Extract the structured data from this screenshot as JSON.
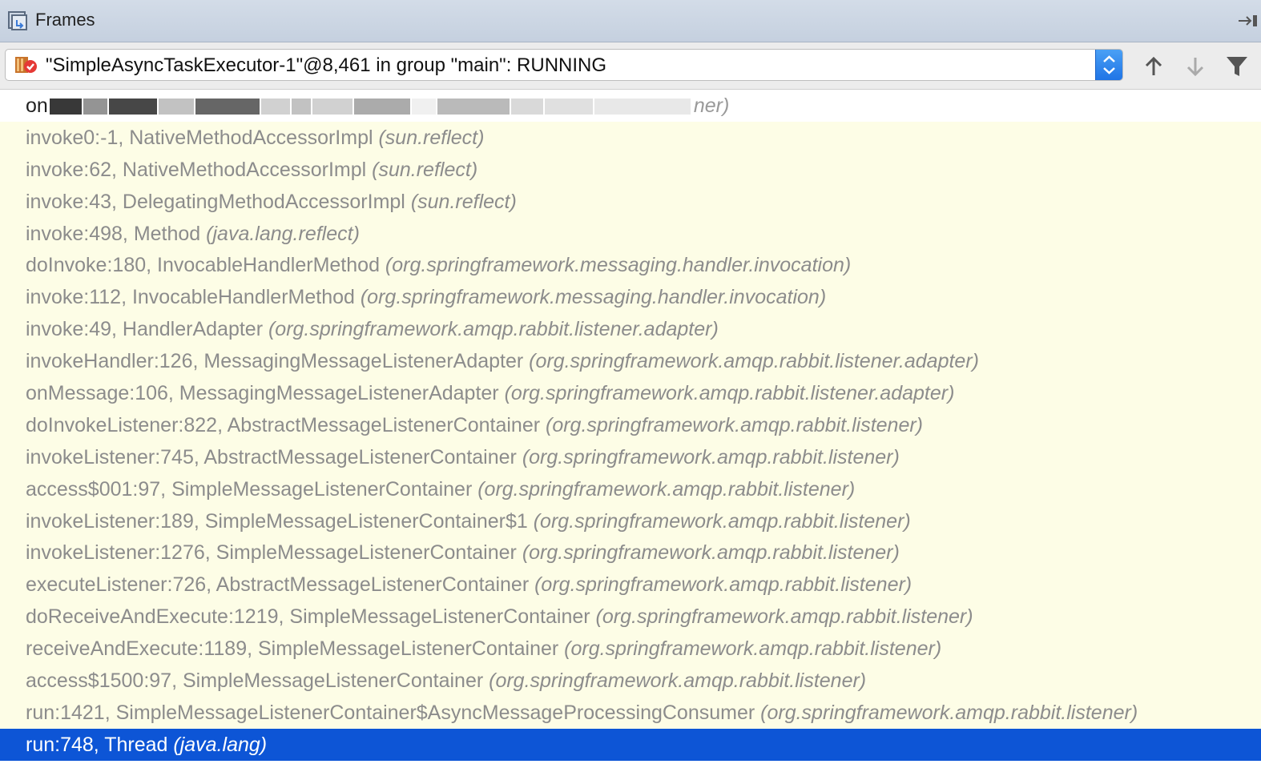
{
  "window": {
    "title": "Frames",
    "icon": "frames-icon",
    "pin_icon": "pin-icon"
  },
  "thread_selector": {
    "value": "\"SimpleAsyncTaskExecutor-1\"@8,461 in group \"main\": RUNNING",
    "icon": "thread-running-icon"
  },
  "toolbar": {
    "up_icon": "arrow-up-icon",
    "down_icon": "arrow-down-icon",
    "filter_icon": "filter-icon"
  },
  "frames": [
    {
      "method": "on",
      "class": "",
      "package": "ner)",
      "redacted": true
    },
    {
      "method": "invoke0:-1, NativeMethodAccessorImpl ",
      "package": "(sun.reflect)"
    },
    {
      "method": "invoke:62, NativeMethodAccessorImpl ",
      "package": "(sun.reflect)"
    },
    {
      "method": "invoke:43, DelegatingMethodAccessorImpl ",
      "package": "(sun.reflect)"
    },
    {
      "method": "invoke:498, Method ",
      "package": "(java.lang.reflect)"
    },
    {
      "method": "doInvoke:180, InvocableHandlerMethod ",
      "package": "(org.springframework.messaging.handler.invocation)"
    },
    {
      "method": "invoke:112, InvocableHandlerMethod ",
      "package": "(org.springframework.messaging.handler.invocation)"
    },
    {
      "method": "invoke:49, HandlerAdapter ",
      "package": "(org.springframework.amqp.rabbit.listener.adapter)"
    },
    {
      "method": "invokeHandler:126, MessagingMessageListenerAdapter ",
      "package": "(org.springframework.amqp.rabbit.listener.adapter)"
    },
    {
      "method": "onMessage:106, MessagingMessageListenerAdapter ",
      "package": "(org.springframework.amqp.rabbit.listener.adapter)"
    },
    {
      "method": "doInvokeListener:822, AbstractMessageListenerContainer ",
      "package": "(org.springframework.amqp.rabbit.listener)"
    },
    {
      "method": "invokeListener:745, AbstractMessageListenerContainer ",
      "package": "(org.springframework.amqp.rabbit.listener)"
    },
    {
      "method": "access$001:97, SimpleMessageListenerContainer ",
      "package": "(org.springframework.amqp.rabbit.listener)"
    },
    {
      "method": "invokeListener:189, SimpleMessageListenerContainer$1 ",
      "package": "(org.springframework.amqp.rabbit.listener)"
    },
    {
      "method": "invokeListener:1276, SimpleMessageListenerContainer ",
      "package": "(org.springframework.amqp.rabbit.listener)"
    },
    {
      "method": "executeListener:726, AbstractMessageListenerContainer ",
      "package": "(org.springframework.amqp.rabbit.listener)"
    },
    {
      "method": "doReceiveAndExecute:1219, SimpleMessageListenerContainer ",
      "package": "(org.springframework.amqp.rabbit.listener)"
    },
    {
      "method": "receiveAndExecute:1189, SimpleMessageListenerContainer ",
      "package": "(org.springframework.amqp.rabbit.listener)"
    },
    {
      "method": "access$1500:97, SimpleMessageListenerContainer ",
      "package": "(org.springframework.amqp.rabbit.listener)"
    },
    {
      "method": "run:1421, SimpleMessageListenerContainer$AsyncMessageProcessingConsumer ",
      "package": "(org.springframework.amqp.rabbit.listener)"
    },
    {
      "method": "run:748, Thread ",
      "package": "(java.lang)",
      "selected": true
    }
  ],
  "colors": {
    "library_frame_bg": "#fdfde6",
    "library_frame_text": "#8c8c8c",
    "selected_bg": "#0d55d6",
    "selected_text": "#ffffff"
  }
}
